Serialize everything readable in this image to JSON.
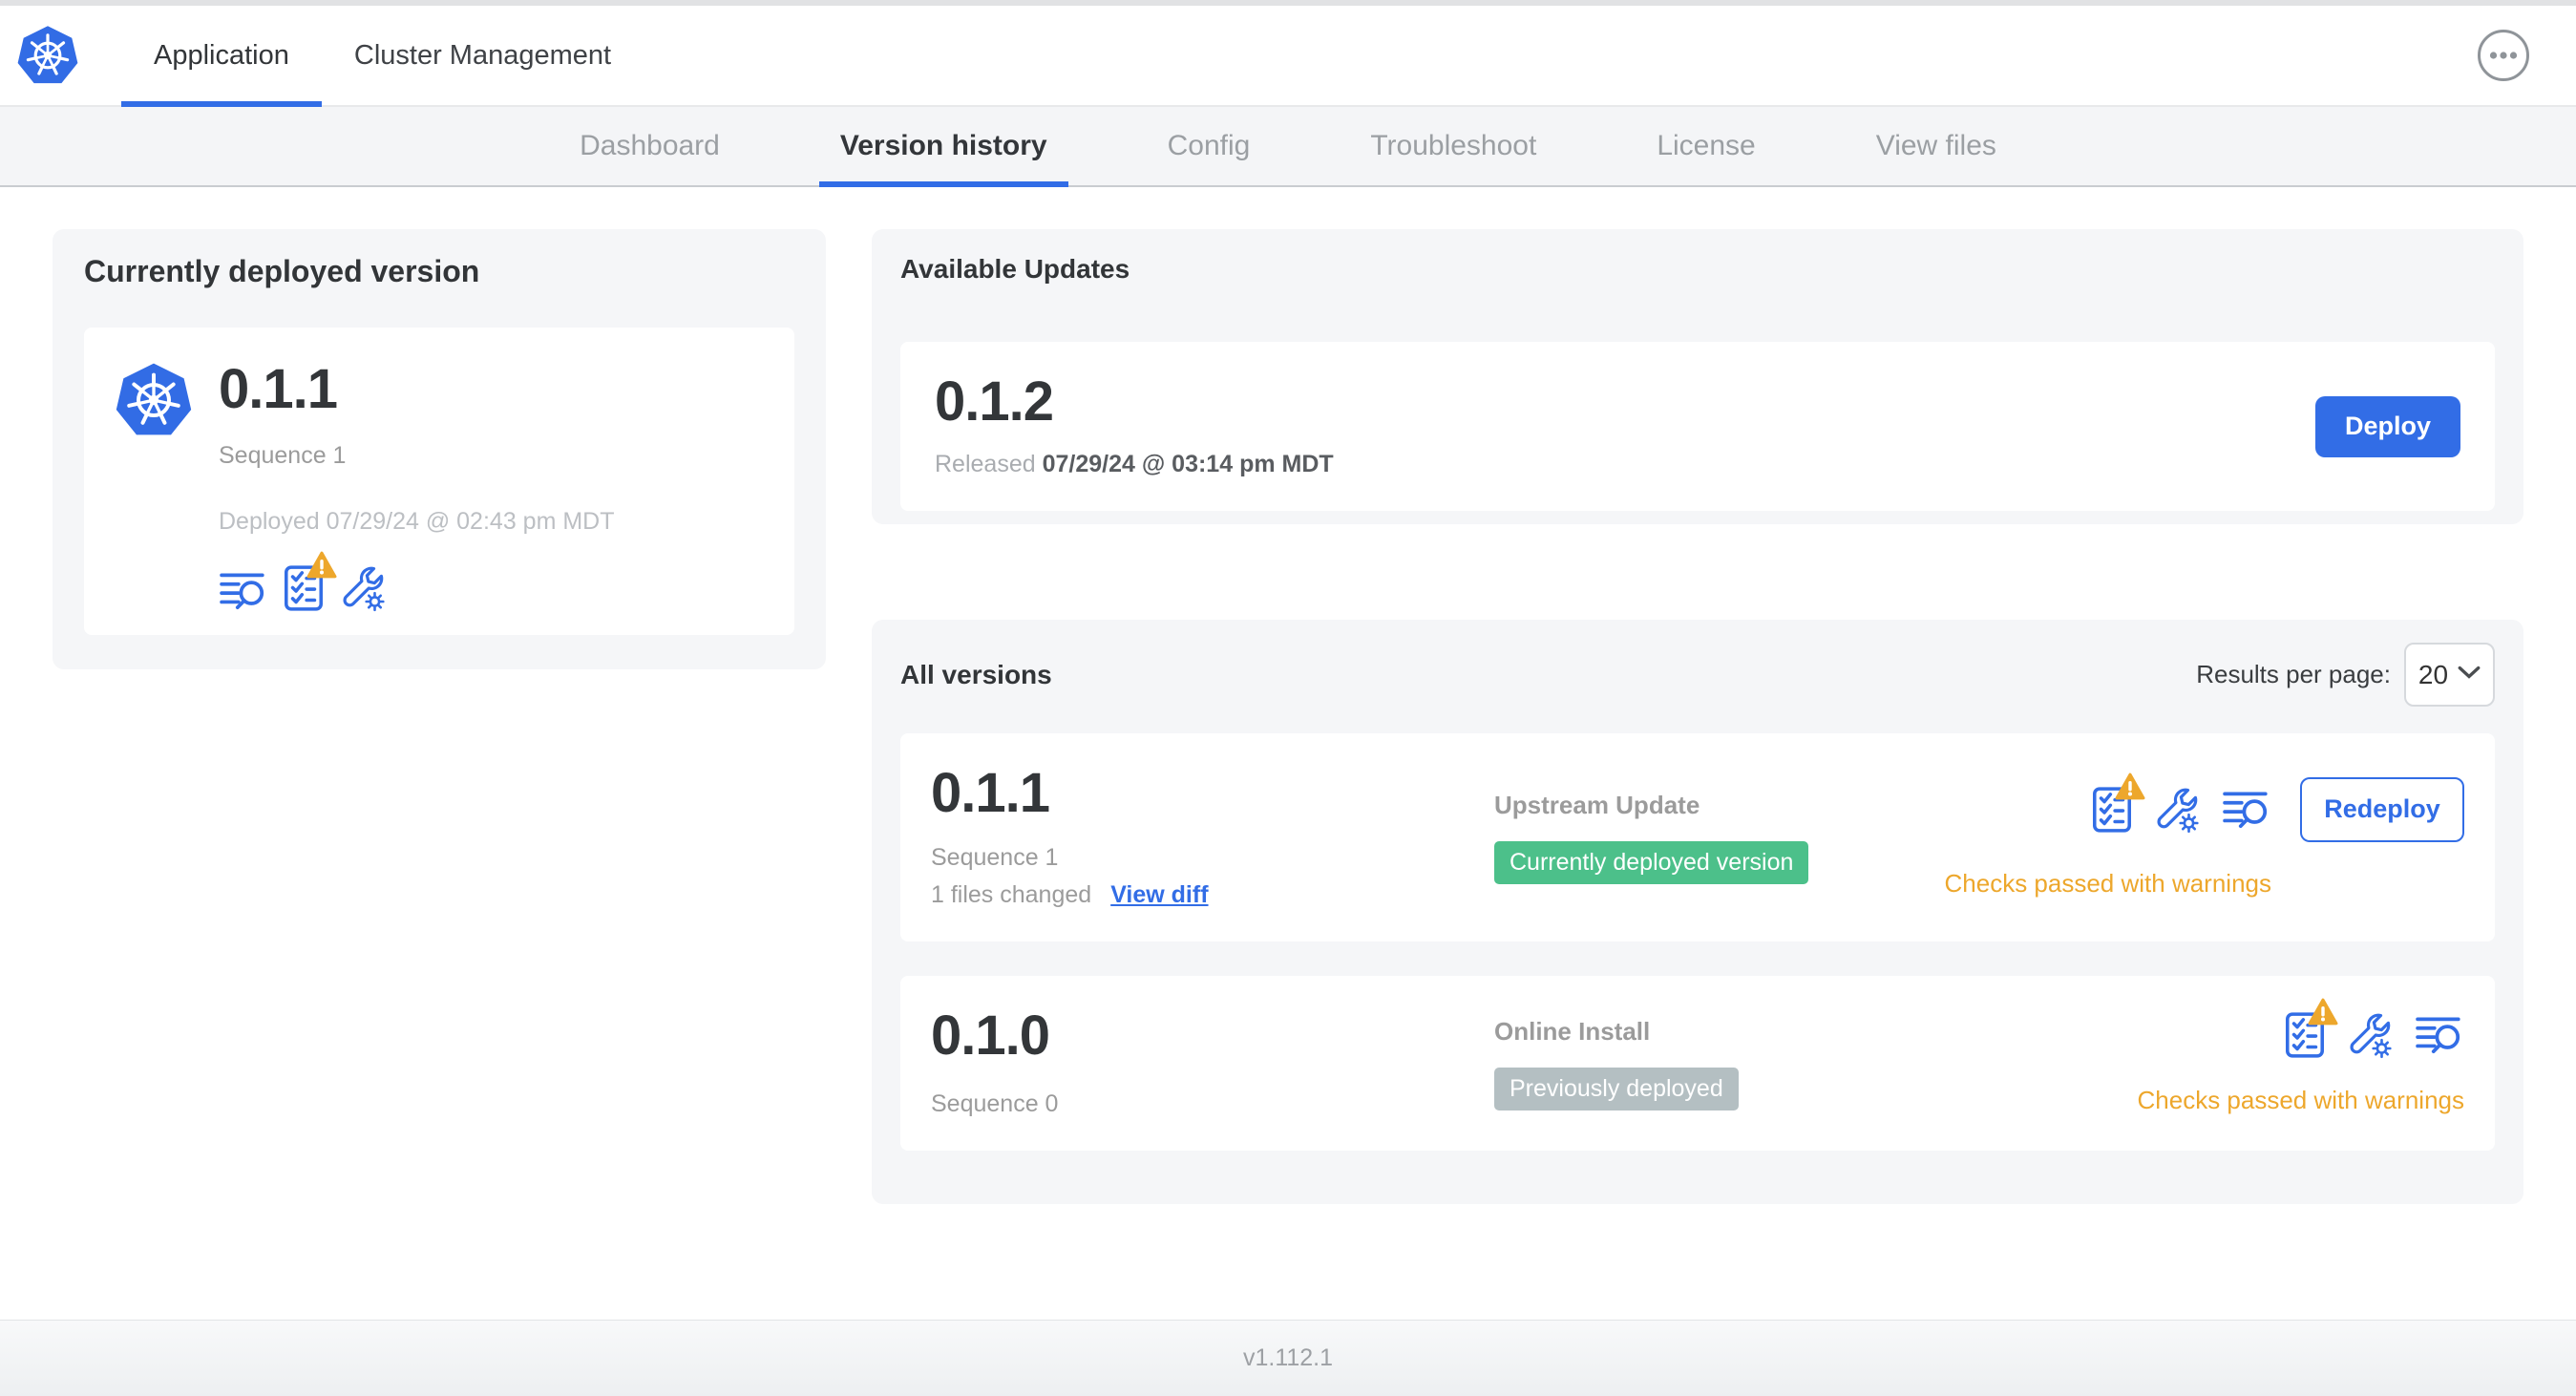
{
  "header": {
    "tabs": [
      {
        "label": "Application",
        "active": true
      },
      {
        "label": "Cluster Management",
        "active": false
      }
    ]
  },
  "subnav": {
    "tabs": [
      {
        "label": "Dashboard",
        "active": false
      },
      {
        "label": "Version history",
        "active": true
      },
      {
        "label": "Config",
        "active": false
      },
      {
        "label": "Troubleshoot",
        "active": false
      },
      {
        "label": "License",
        "active": false
      },
      {
        "label": "View files",
        "active": false
      }
    ]
  },
  "current": {
    "title": "Currently deployed version",
    "version": "0.1.1",
    "sequence": "Sequence 1",
    "deployed": "Deployed 07/29/24 @ 02:43 pm MDT"
  },
  "updates": {
    "title": "Available Updates",
    "version": "0.1.2",
    "released_label": "Released",
    "released_value": "07/29/24 @ 03:14 pm MDT",
    "deploy_label": "Deploy"
  },
  "versions": {
    "title": "All versions",
    "results_label": "Results per page:",
    "results_value": "20",
    "rows": [
      {
        "version": "0.1.1",
        "sequence": "Sequence 1",
        "files_changed": "1 files changed",
        "view_diff": "View diff",
        "source": "Upstream Update",
        "badge": "Currently deployed version",
        "status": "Checks passed with warnings",
        "action": "Redeploy"
      },
      {
        "version": "0.1.0",
        "sequence": "Sequence 0",
        "source": "Online Install",
        "badge": "Previously deployed",
        "status": "Checks passed with warnings"
      }
    ]
  },
  "footer": {
    "version": "v1.112.1"
  },
  "colors": {
    "accent_blue": "#326de6",
    "kubernetes_blue": "#326ce5",
    "success_badge": "#4cc08a",
    "neutral_badge": "#b4bfc2",
    "warning_amber": "#eda72c"
  },
  "icons": {
    "logo": "kubernetes-helm-wheel",
    "more": "ellipsis-in-circle",
    "deploy_logs": "text-lines-with-magnifier",
    "preflight": "checklist-clipboard",
    "warning": "warning-triangle",
    "config": "wrench-with-gear",
    "select_chevron": "chevron-down"
  }
}
